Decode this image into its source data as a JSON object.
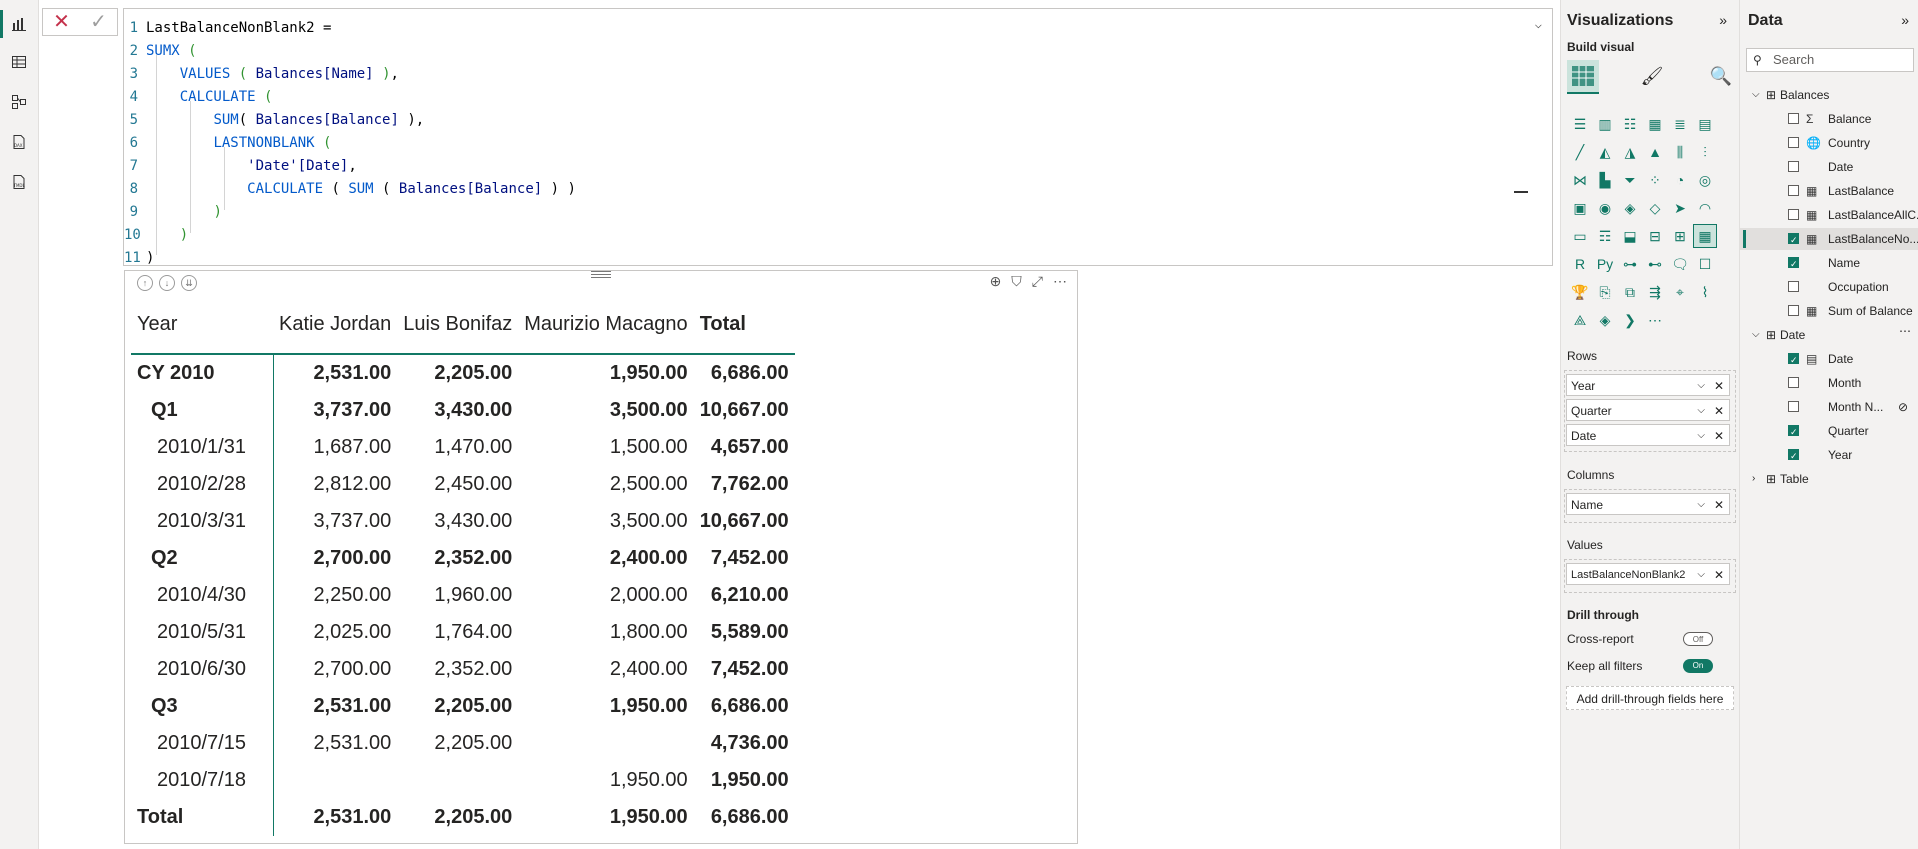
{
  "formula": {
    "lines": [
      {
        "n": "1",
        "tokens": [
          [
            "plain",
            "LastBalanceNonBlank2 ="
          ]
        ]
      },
      {
        "n": "2",
        "tokens": [
          [
            "fn",
            "SUMX"
          ],
          [
            "plain",
            " "
          ],
          [
            "br",
            "("
          ]
        ]
      },
      {
        "n": "3",
        "tokens": [
          [
            "plain",
            "    "
          ],
          [
            "fn",
            "VALUES"
          ],
          [
            "plain",
            " "
          ],
          [
            "br",
            "("
          ],
          [
            "plain",
            " "
          ],
          [
            "col",
            "Balances[Name]"
          ],
          [
            "plain",
            " "
          ],
          [
            "br",
            ")"
          ],
          [
            "plain",
            ","
          ]
        ]
      },
      {
        "n": "4",
        "tokens": [
          [
            "plain",
            "    "
          ],
          [
            "fn",
            "CALCULATE"
          ],
          [
            "plain",
            " "
          ],
          [
            "br",
            "("
          ]
        ]
      },
      {
        "n": "5",
        "tokens": [
          [
            "plain",
            "        "
          ],
          [
            "fn",
            "SUM"
          ],
          [
            "plain",
            "( "
          ],
          [
            "col",
            "Balances[Balance]"
          ],
          [
            "plain",
            " ),"
          ]
        ]
      },
      {
        "n": "6",
        "tokens": [
          [
            "plain",
            "        "
          ],
          [
            "fn",
            "LASTNONBLANK"
          ],
          [
            "plain",
            " "
          ],
          [
            "br",
            "("
          ]
        ]
      },
      {
        "n": "7",
        "tokens": [
          [
            "plain",
            "            "
          ],
          [
            "str",
            "'Date'[Date]"
          ],
          [
            "plain",
            ","
          ]
        ]
      },
      {
        "n": "8",
        "tokens": [
          [
            "plain",
            "            "
          ],
          [
            "fn",
            "CALCULATE"
          ],
          [
            "plain",
            " ( "
          ],
          [
            "fn",
            "SUM"
          ],
          [
            "plain",
            " ( "
          ],
          [
            "col",
            "Balances[Balance]"
          ],
          [
            "plain",
            " ) )"
          ]
        ]
      },
      {
        "n": "9",
        "tokens": [
          [
            "plain",
            "        "
          ],
          [
            "br",
            ")"
          ]
        ]
      },
      {
        "n": "10",
        "tokens": [
          [
            "plain",
            "    "
          ],
          [
            "br",
            ")"
          ]
        ]
      },
      {
        "n": "11",
        "tokens": [
          [
            "plain",
            ")"
          ]
        ]
      }
    ],
    "cancel_glyph": "✕",
    "commit_glyph": "✓"
  },
  "matrix": {
    "headers": [
      "Year",
      "Katie Jordan",
      "Luis Bonifaz",
      "Maurizio Macagno",
      "Total"
    ],
    "rows": [
      {
        "label": "CY 2010",
        "level": 0,
        "bold": true,
        "values": [
          "2,531.00",
          "2,205.00",
          "1,950.00",
          "6,686.00"
        ]
      },
      {
        "label": "Q1",
        "level": 1,
        "bold": true,
        "values": [
          "3,737.00",
          "3,430.00",
          "3,500.00",
          "10,667.00"
        ]
      },
      {
        "label": "2010/1/31",
        "level": 2,
        "bold": false,
        "values": [
          "1,687.00",
          "1,470.00",
          "1,500.00",
          "4,657.00"
        ]
      },
      {
        "label": "2010/2/28",
        "level": 2,
        "bold": false,
        "values": [
          "2,812.00",
          "2,450.00",
          "2,500.00",
          "7,762.00"
        ]
      },
      {
        "label": "2010/3/31",
        "level": 2,
        "bold": false,
        "values": [
          "3,737.00",
          "3,430.00",
          "3,500.00",
          "10,667.00"
        ]
      },
      {
        "label": "Q2",
        "level": 1,
        "bold": true,
        "values": [
          "2,700.00",
          "2,352.00",
          "2,400.00",
          "7,452.00"
        ]
      },
      {
        "label": "2010/4/30",
        "level": 2,
        "bold": false,
        "values": [
          "2,250.00",
          "1,960.00",
          "2,000.00",
          "6,210.00"
        ]
      },
      {
        "label": "2010/5/31",
        "level": 2,
        "bold": false,
        "values": [
          "2,025.00",
          "1,764.00",
          "1,800.00",
          "5,589.00"
        ]
      },
      {
        "label": "2010/6/30",
        "level": 2,
        "bold": false,
        "values": [
          "2,700.00",
          "2,352.00",
          "2,400.00",
          "7,452.00"
        ]
      },
      {
        "label": "Q3",
        "level": 1,
        "bold": true,
        "values": [
          "2,531.00",
          "2,205.00",
          "1,950.00",
          "6,686.00"
        ]
      },
      {
        "label": "2010/7/15",
        "level": 2,
        "bold": false,
        "values": [
          "2,531.00",
          "2,205.00",
          "",
          "4,736.00"
        ]
      },
      {
        "label": "2010/7/18",
        "level": 2,
        "bold": false,
        "values": [
          "",
          "",
          "1,950.00",
          "1,950.00"
        ]
      },
      {
        "label": "Total",
        "level": 0,
        "bold": true,
        "values": [
          "2,531.00",
          "2,205.00",
          "1,950.00",
          "6,686.00"
        ]
      }
    ]
  },
  "visualizations": {
    "title": "Visualizations",
    "build_visual": "Build visual",
    "sections": {
      "rows": "Rows",
      "columns": "Columns",
      "values": "Values",
      "drill": "Drill through",
      "cross_report": "Cross-report",
      "keep_filters": "Keep all filters",
      "add_drill": "Add drill-through fields here"
    },
    "rows_fields": [
      "Year",
      "Quarter",
      "Date"
    ],
    "columns_fields": [
      "Name"
    ],
    "values_fields": [
      "LastBalanceNonBlank2"
    ],
    "toggles": {
      "cross_report": "Off",
      "keep_filters": "On"
    }
  },
  "data_pane": {
    "title": "Data",
    "search_placeholder": "Search",
    "tables": [
      {
        "name": "Balances",
        "fields": [
          {
            "name": "Balance",
            "icon": "Σ",
            "checked": false
          },
          {
            "name": "Country",
            "icon": "🌐",
            "checked": false
          },
          {
            "name": "Date",
            "icon": "",
            "checked": false
          },
          {
            "name": "LastBalance",
            "icon": "▦",
            "checked": false
          },
          {
            "name": "LastBalanceAllC...",
            "icon": "▦",
            "checked": false
          },
          {
            "name": "LastBalanceNo...",
            "icon": "▦",
            "checked": true
          },
          {
            "name": "Name",
            "icon": "",
            "checked": true
          },
          {
            "name": "Occupation",
            "icon": "",
            "checked": false
          },
          {
            "name": "Sum of Balance",
            "icon": "▦",
            "checked": false
          }
        ]
      },
      {
        "name": "Date",
        "fields": [
          {
            "name": "Date",
            "icon": "▤",
            "checked": true
          },
          {
            "name": "Month",
            "icon": "",
            "checked": false
          },
          {
            "name": "Month N...",
            "icon": "",
            "checked": false
          },
          {
            "name": "Quarter",
            "icon": "",
            "checked": true
          },
          {
            "name": "Year",
            "icon": "",
            "checked": true
          }
        ]
      },
      {
        "name": "Table",
        "fields": []
      }
    ]
  },
  "colors": {
    "accent": "#117865",
    "selected_bg": "#cbe3dc"
  }
}
